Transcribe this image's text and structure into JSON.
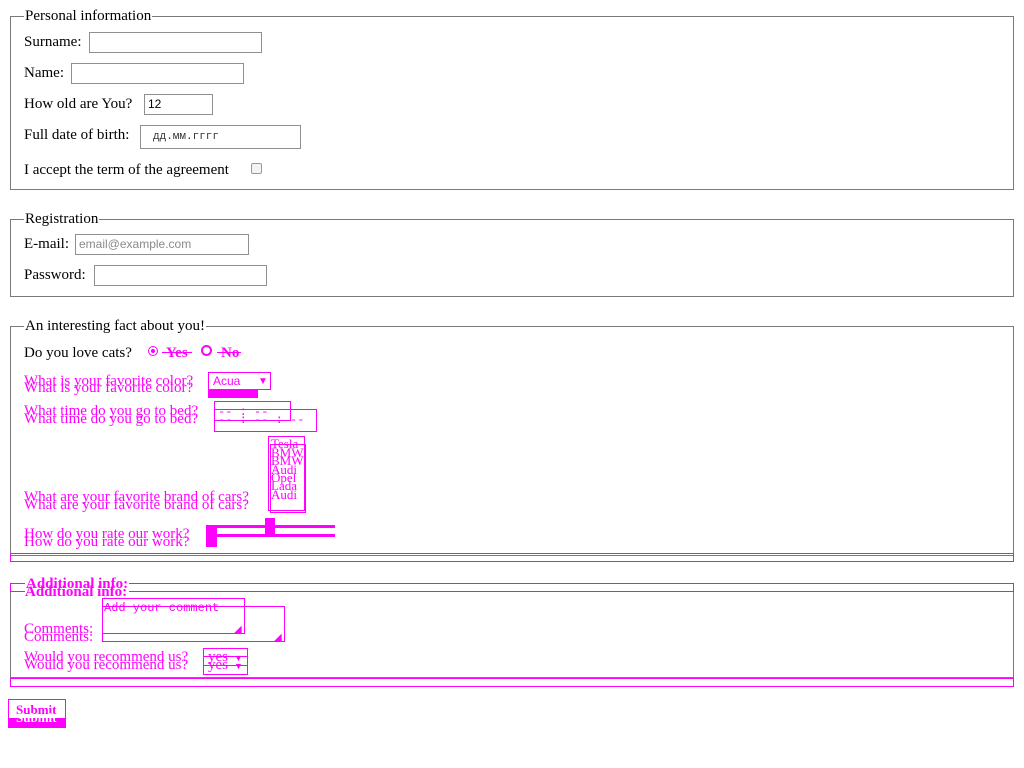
{
  "personal": {
    "legend": "Personal information",
    "surname_label": "Surname:",
    "name_label": "Name:",
    "age_label": "How old are You?",
    "age_value": "12",
    "dob_label": "Full date of birth:",
    "dob_placeholder": "дд.мм.гггг",
    "agreement_label": "I accept the term of the agreement"
  },
  "registration": {
    "legend": "Registration",
    "email_label": "E-mail:",
    "email_placeholder": "email@example.com",
    "password_label": "Password:"
  },
  "fact": {
    "legend": "An interesting fact about you!",
    "cats_label": "Do you love cats?",
    "yes_label": "Yes",
    "no_label": "No",
    "color_label": "What is your favorite color?",
    "color_value": "Acua",
    "bed_label": "What time do you go to bed?",
    "bed_time": "-- : --",
    "bed_time_sec": "-- : -- : --",
    "cars_label": "What are your favorite brand of cars?",
    "cars_options": [
      "Tesla",
      "BMW",
      "BMW",
      "Audi",
      "Opel",
      "Lada",
      "Audi"
    ],
    "rate_label": "How do you rate our work?"
  },
  "additional": {
    "legend": "Additional info:",
    "comments_label": "Comments:",
    "comments_placeholder": "Add your comment",
    "recommend_label": "Would you recommend us?",
    "recommend_value": "yes"
  },
  "submit_label": "Submit",
  "colors": {
    "accent": "#ff00ff",
    "border": "#7a7a7a"
  }
}
